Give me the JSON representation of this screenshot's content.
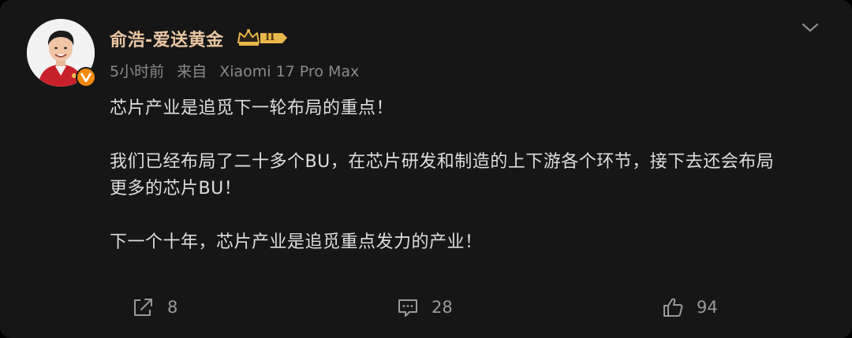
{
  "post": {
    "username": "俞浩-爱送黄金",
    "vip_level": "II",
    "time": "5小时前",
    "source_prefix": "来自",
    "device": "Xiaomi 17 Pro Max",
    "paragraphs": [
      "芯片产业是追觅下一轮布局的重点！",
      "我们已经布局了二十多个BU，在芯片研发和制造的上下游各个环节，接下去还会布局",
      "更多的芯片BU！",
      "下一个十年，芯片产业是追觅重点发力的产业！"
    ]
  },
  "actions": {
    "share_count": "8",
    "comment_count": "28",
    "like_count": "94"
  },
  "icons": {
    "more": "chevron-down-icon",
    "share": "share-icon",
    "comment": "comment-icon",
    "like": "thumbs-up-icon",
    "verified": "verified-v-icon",
    "vip": "crown-icon"
  },
  "colors": {
    "background": "#161616",
    "username": "#e9c6a2",
    "verified": "#f28a0e",
    "vip_gold": "#e8b84a",
    "text": "#dedede",
    "meta": "#8a8a8a"
  }
}
